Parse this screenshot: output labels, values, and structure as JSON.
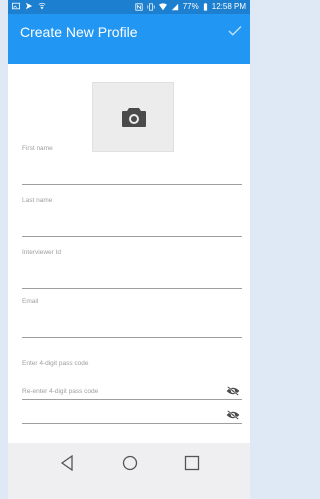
{
  "status_bar": {
    "battery": "77%",
    "time": "12:58 PM"
  },
  "app_bar": {
    "title": "Create New Profile",
    "confirm_icon": "check-icon"
  },
  "photo": {
    "icon": "camera-icon"
  },
  "form": {
    "fields": [
      {
        "label": "First name",
        "value": ""
      },
      {
        "label": "Last name",
        "value": ""
      },
      {
        "label": "Interviewer Id",
        "value": ""
      },
      {
        "label": "Email",
        "value": ""
      },
      {
        "label": "Enter 4-digit pass code",
        "value": "",
        "icon": "visibility-off-icon"
      },
      {
        "label": "Re-enter 4-digit pass code",
        "value": "",
        "icon": "visibility-off-icon"
      }
    ]
  },
  "nav": {
    "back_icon": "back-icon",
    "home_icon": "home-icon",
    "recents_icon": "recents-icon"
  },
  "colors": {
    "primary": "#2196f3",
    "status_bar": "#1d7fd0",
    "accent": "#ff9800"
  }
}
